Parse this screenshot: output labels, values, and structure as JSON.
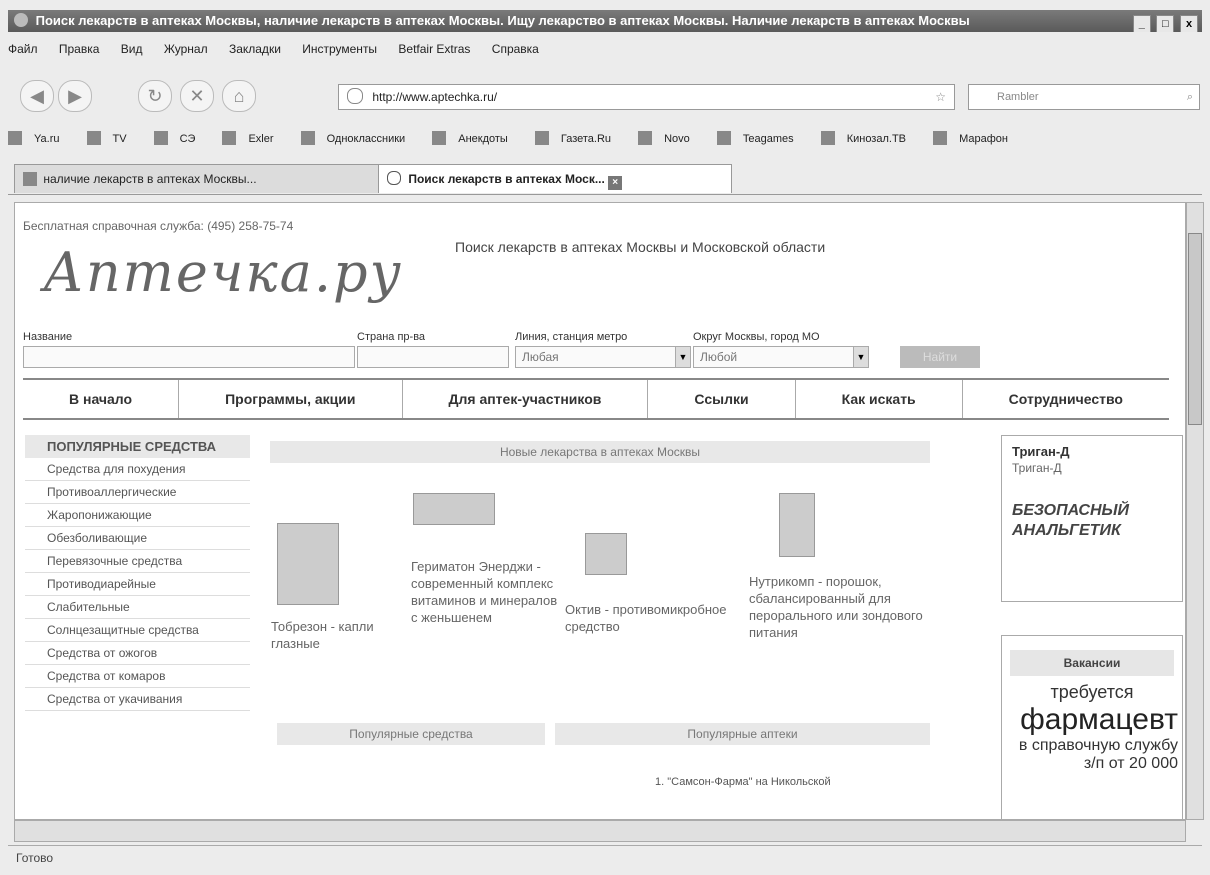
{
  "window": {
    "title": "Поиск лекарств в аптеках Москвы, наличие лекарств в аптеках Москвы. Ищу лекарство в аптеках Москвы. Наличие лекарств в аптеках Москвы",
    "minimize": "_",
    "maximize": "□",
    "close": "x"
  },
  "menu": [
    "Файл",
    "Правка",
    "Вид",
    "Журнал",
    "Закладки",
    "Инструменты",
    "Betfair Extras",
    "Справка"
  ],
  "toolbar": {
    "url": "http://www.aptechka.ru/",
    "search_placeholder": "Rambler"
  },
  "bookmarks": [
    "Ya.ru",
    "TV",
    "СЭ",
    "Exler",
    "Одноклассники",
    "Анекдоты",
    "Газета.Ru",
    "Novo",
    "Teagames",
    "Кинозал.ТВ",
    "Марафон"
  ],
  "tabs": [
    {
      "label": "наличие лекарств в аптеках Москвы..."
    },
    {
      "label": "Поиск лекарств в аптеках Моск..."
    }
  ],
  "page": {
    "phone": "Бесплатная справочная служба: (495) 258-75-74",
    "logo": "Аптечка.ру",
    "tagline": "Поиск лекарств в аптеках Москвы и Московской области",
    "form": {
      "name_label": "Название",
      "country_label": "Страна пр-ва",
      "metro_label": "Линия, станция метро",
      "district_label": "Округ Москвы, город МО",
      "metro_value": "Любая",
      "district_value": "Любой",
      "find_button": "Найти"
    },
    "nav": [
      "В начало",
      "Программы, акции",
      "Для аптек-участников",
      "Ссылки",
      "Как искать",
      "Сотрудничество"
    ],
    "sidebar": {
      "header": "ПОПУЛЯРНЫЕ СРЕДСТВА",
      "items": [
        "Средства для похудения",
        "Противоаллергические",
        "Жаропонижающие",
        "Обезболивающие",
        "Перевязочные средства",
        "Противодиарейные",
        "Слабительные",
        "Солнцезащитные средства",
        "Средства от ожогов",
        "Средства от комаров",
        "Средства от укачивания"
      ]
    },
    "new_drugs_header": "Новые лекарства в аптеках Москвы",
    "products": [
      "Тобрезон - капли глазные",
      "Гериматон Энерджи - современный комплекс витаминов и минералов с женьшенем",
      "Октив - противомикробное средство",
      "Нутрикомп - порошок, сбалансированный для перорального или зондового питания"
    ],
    "popular_drugs_header": "Популярные средства",
    "popular_pharmacies_header": "Популярные аптеки",
    "popular_pharmacies": [
      "1. \"Самсон-Фарма\" на Никольской"
    ],
    "right_ad": {
      "title": "Триган-Д",
      "subtitle": "Триган-Д",
      "slogan": "БЕЗОПАСНЫЙ АНАЛЬГЕТИК"
    },
    "vacancy": {
      "header": "Вакансии",
      "line1": "требуется",
      "line2": "фармацевт",
      "line3": "в справочную службу",
      "line4": "з/п от 20 000"
    }
  },
  "status": "Готово"
}
